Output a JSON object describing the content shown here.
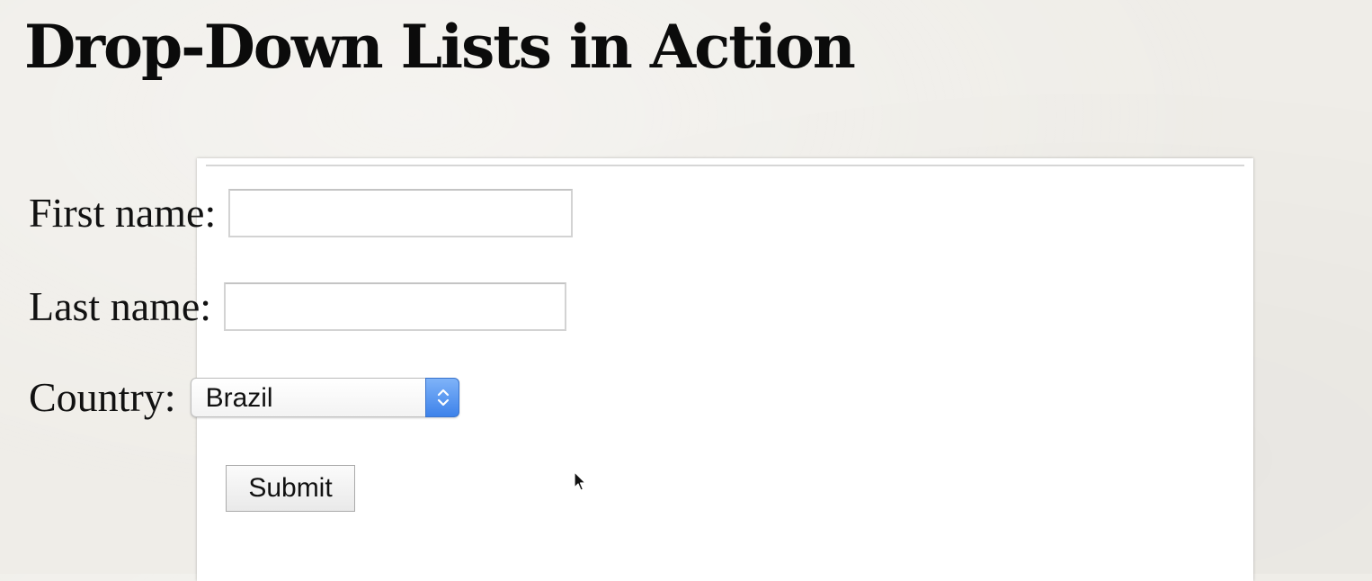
{
  "slide": {
    "title": "Drop-Down Lists in Action"
  },
  "form": {
    "first_name_label": "First name:",
    "first_name_value": "",
    "last_name_label": "Last name:",
    "last_name_value": "",
    "country_label": "Country:",
    "country_selected": "Brazil",
    "submit_label": "Submit"
  },
  "colors": {
    "select_arrow_accent": "#4a8ef0",
    "panel_background": "#ffffff",
    "slide_background": "#efede8"
  },
  "icons": {
    "select_arrows": "chevron-up-down-icon",
    "cursor": "mouse-pointer-icon"
  }
}
